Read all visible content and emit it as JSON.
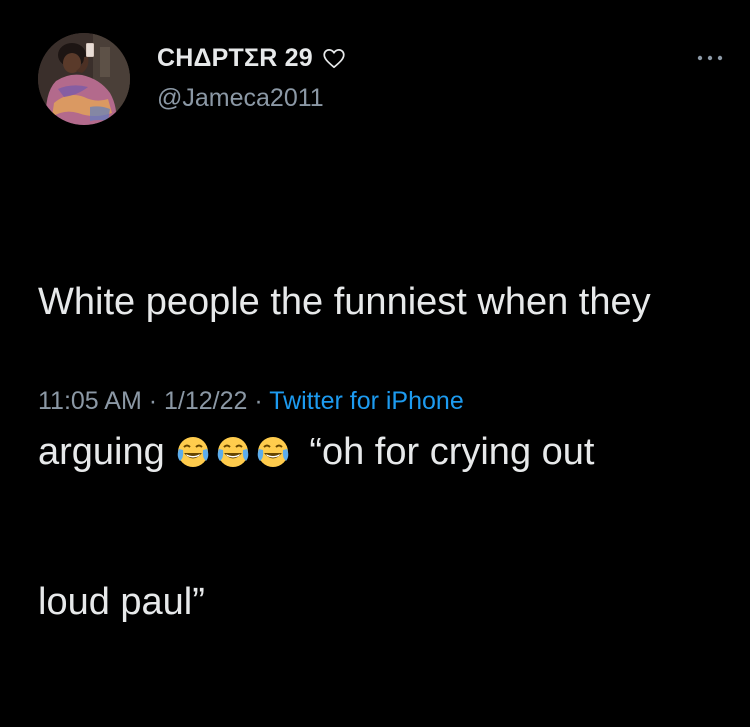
{
  "author": {
    "display_name": "CHΔPTΣR 29",
    "badge_icon": "heart-outline-icon",
    "handle": "@Jameca2011",
    "avatar": "profile-photo"
  },
  "menu": {
    "icon": "more-options-icon"
  },
  "tweet": {
    "line1": "White people the funniest when they",
    "line2_before": "arguing",
    "emoji_icon": "face-with-tears-of-joy-icon",
    "emoji_count": 3,
    "line2_after": "“oh for crying out",
    "line3": "loud paul”"
  },
  "meta": {
    "time": "11:05 AM",
    "separator1": " · ",
    "date": "1/12/22",
    "separator2": " · ",
    "source": "Twitter for iPhone"
  },
  "colors": {
    "background": "#000000",
    "text": "#e7e9ea",
    "secondary": "#8b98a5",
    "link": "#1d9bf0"
  }
}
